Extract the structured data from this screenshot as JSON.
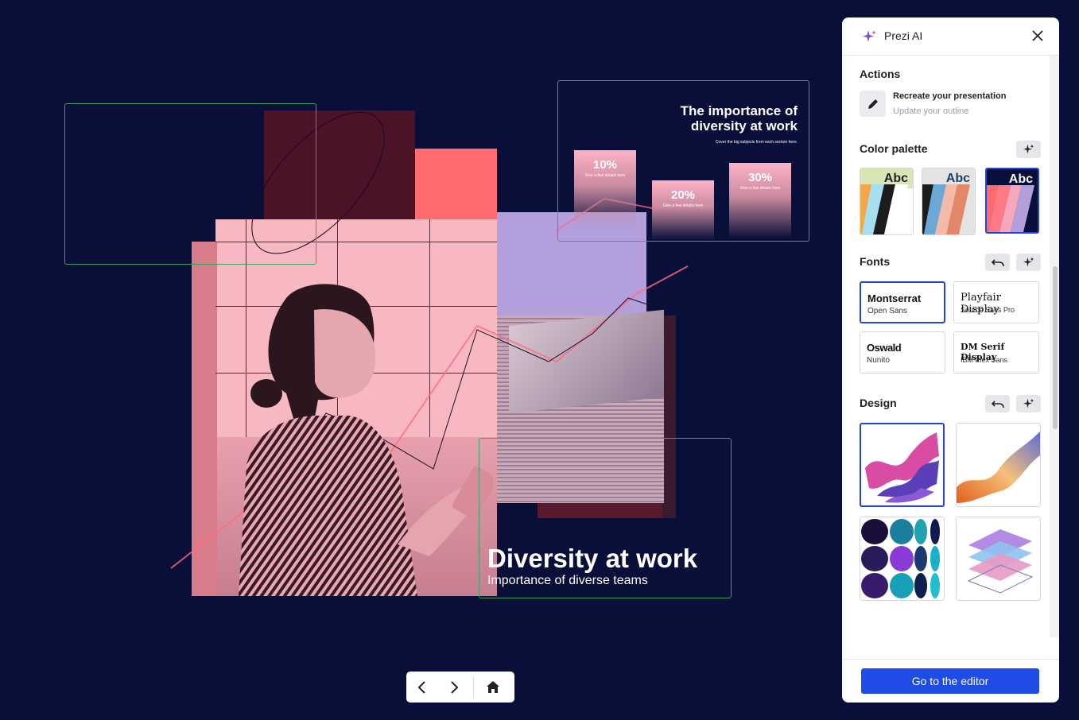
{
  "slides": {
    "main_title": "Diversity at work",
    "main_subtitle": "Importance of diverse teams",
    "mini_title": "The importance of diversity at work",
    "mini_subtitle": "Cover the big subjects from each section here.",
    "mini_stats": [
      {
        "value": "10%",
        "detail": "Give a few details here"
      },
      {
        "value": "20%",
        "detail": "Give a few details here"
      },
      {
        "value": "30%",
        "detail": "Give a few details here"
      }
    ]
  },
  "nav": {
    "prev_icon": "chevron-left-icon",
    "next_icon": "chevron-right-icon",
    "home_icon": "home-icon"
  },
  "panel": {
    "title": "Prezi AI",
    "actions_title": "Actions",
    "action_label": "Recreate your presentation",
    "action_sub": "Update your outline",
    "color_palette_title": "Color palette",
    "palette_label": "Abc",
    "fonts_title": "Fonts",
    "fonts": [
      {
        "primary": "Montserrat",
        "secondary": "Open Sans",
        "selected": true
      },
      {
        "primary": "Playfair Display",
        "secondary": "Source Sans Pro",
        "selected": false
      },
      {
        "primary": "Oswald",
        "secondary": "Nunito",
        "selected": false
      },
      {
        "primary": "DM Serif Display",
        "secondary": "IBM Plex Sans",
        "selected": false
      }
    ],
    "design_title": "Design",
    "cta": "Go to the editor"
  },
  "colors": {
    "background": "#0a0f3a",
    "accent": "#1f4be6",
    "frame": "#3aa363"
  }
}
